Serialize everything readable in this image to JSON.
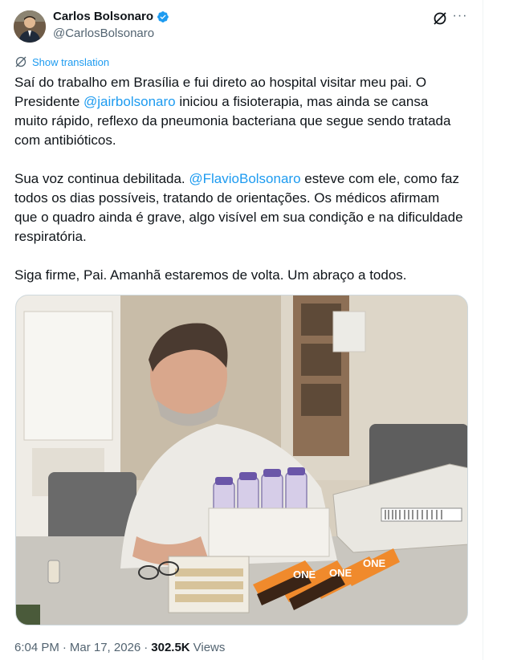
{
  "author": {
    "name": "Carlos Bolsonaro",
    "handle": "@CarlosBolsonaro",
    "verified": true,
    "verified_color": "#1d9bf0"
  },
  "actions": {
    "grok_icon": "grok-icon",
    "more_icon": "more-icon",
    "more_label": "···"
  },
  "translation": {
    "label": "Show translation",
    "icon": "globe-icon"
  },
  "tweet": {
    "p1_a": "Saí do trabalho em Brasília e fui direto ao hospital visitar meu pai. O Presidente ",
    "p1_mention": "@jairbolsonaro",
    "p1_b": " iniciou a fisioterapia, mas ainda se cansa muito rápido, reflexo da pneumonia bacteriana que segue sendo tratada com antibióticos.",
    "p2_a": "Sua voz continua debilitada. ",
    "p2_mention": "@FlavioBolsonaro",
    "p2_b": " esteve com ele, como faz todos os dias possíveis, tratando de orientações. Os médicos afirmam que o quadro ainda é grave, algo visível em sua condição e na dificuldade respiratória.",
    "p3": "Siga firme, Pai. Amanhã estaremos de volta. Um abraço a todos."
  },
  "media": {
    "boxes_text": [
      "ONE",
      "ONE",
      "ONE"
    ]
  },
  "meta": {
    "time": "6:04 PM",
    "sep1": "·",
    "date": "Mar 17, 2026",
    "sep2": "·",
    "views_count": "302.5K",
    "views_label": "Views"
  },
  "colors": {
    "accent": "#1d9bf0",
    "text": "#0f1419",
    "secondary": "#536471"
  }
}
